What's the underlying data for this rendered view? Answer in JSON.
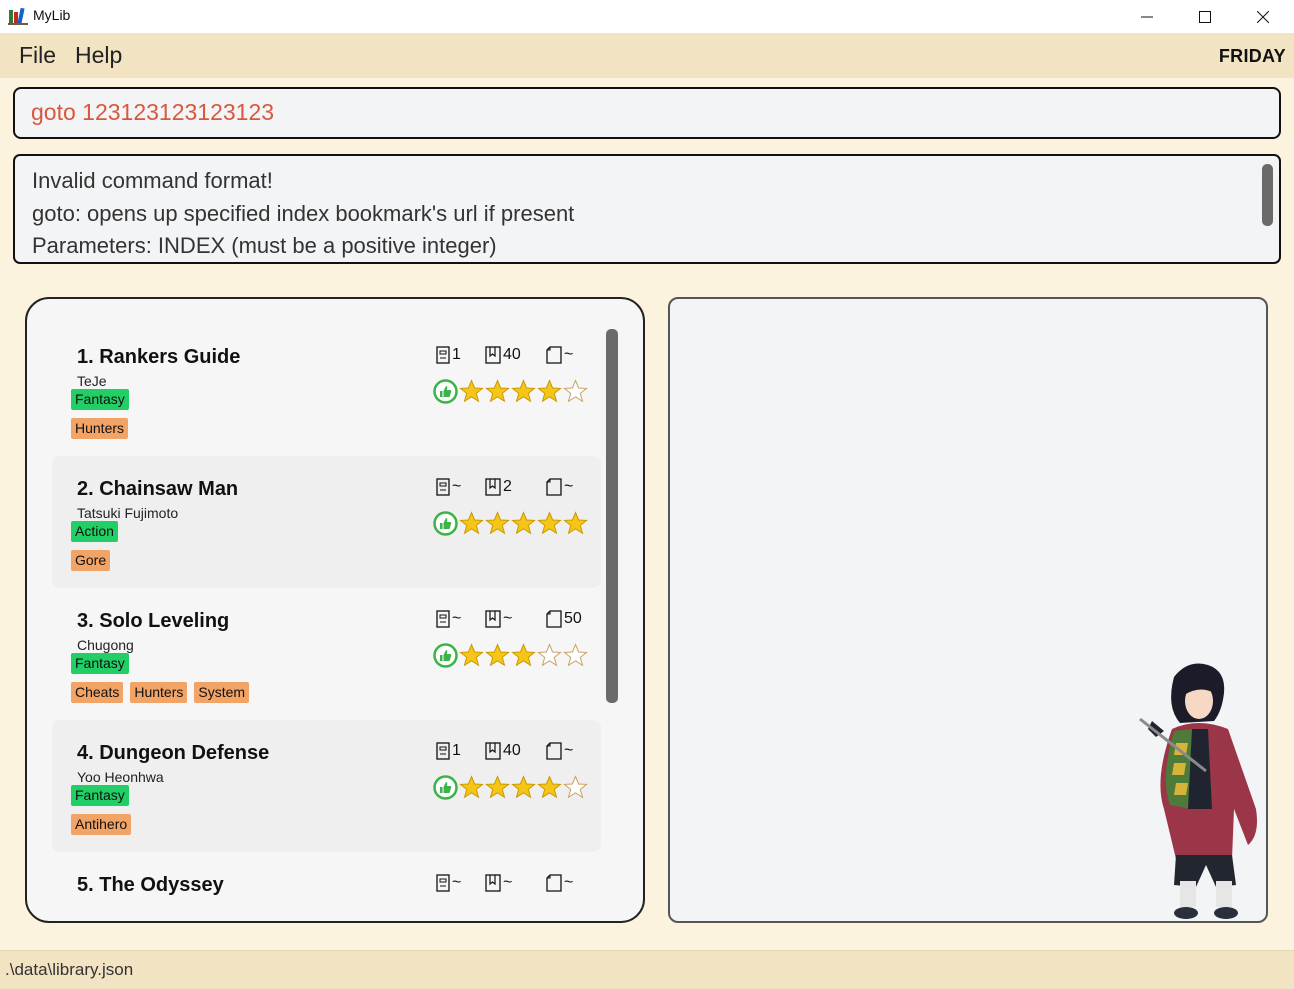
{
  "window": {
    "title": "MyLib"
  },
  "menu": {
    "file": "File",
    "help": "Help"
  },
  "day": "FRIDAY",
  "command": {
    "value": "goto 123123123123123"
  },
  "result": {
    "lines": [
      "Invalid command format!",
      "goto: opens up specified index bookmark's url if present",
      "Parameters: INDEX (must be a positive integer)"
    ]
  },
  "books": [
    {
      "title": "1. Rankers Guide",
      "author": "TeJe",
      "genres": [
        "Fantasy"
      ],
      "tags": [
        "Hunters"
      ],
      "chapter": "1",
      "volume": "40",
      "page": "~",
      "rating": 4
    },
    {
      "title": "2. Chainsaw Man",
      "author": "Tatsuki Fujimoto",
      "genres": [
        "Action"
      ],
      "tags": [
        "Gore"
      ],
      "chapter": "~",
      "volume": "2",
      "page": "~",
      "rating": 5
    },
    {
      "title": "3. Solo Leveling",
      "author": "Chugong",
      "genres": [
        "Fantasy"
      ],
      "tags": [
        "Cheats",
        "Hunters",
        "System"
      ],
      "chapter": "~",
      "volume": "~",
      "page": "50",
      "rating": 3
    },
    {
      "title": "4. Dungeon Defense",
      "author": "Yoo Heonhwa",
      "genres": [
        "Fantasy"
      ],
      "tags": [
        "Antihero"
      ],
      "chapter": "1",
      "volume": "40",
      "page": "~",
      "rating": 4
    },
    {
      "title": "5. The Odyssey",
      "author": "",
      "genres": [],
      "tags": [],
      "chapter": "~",
      "volume": "~",
      "page": "~",
      "rating": 0
    }
  ],
  "status": {
    "path": ".\\data\\library.json"
  },
  "colors": {
    "genre_tag": "#22cf66",
    "label_tag": "#f2a366",
    "command_text": "#d9573d",
    "star_fill": "#f5c518",
    "thumb": "#3db24a"
  }
}
